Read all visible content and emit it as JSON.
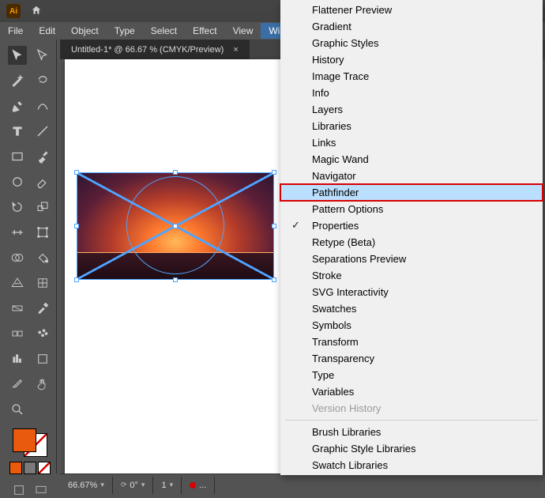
{
  "app": {
    "logo_text": "Ai"
  },
  "menus": [
    "File",
    "Edit",
    "Object",
    "Type",
    "Select",
    "Effect",
    "View",
    "Window"
  ],
  "open_menu": "Window",
  "tab": {
    "title": "Untitled-1* @ 66.67 % (CMYK/Preview)",
    "close": "×"
  },
  "status": {
    "zoom": "66.67%",
    "rotate": "0°",
    "layer": "1",
    "more": "..."
  },
  "swatches": {
    "fill": "#ea5a0e",
    "mini1": "#ea5a0e",
    "mini2": "#7a7a7a"
  },
  "window_menu": {
    "items": [
      {
        "label": "Flattener Preview"
      },
      {
        "label": "Gradient"
      },
      {
        "label": "Graphic Styles"
      },
      {
        "label": "History"
      },
      {
        "label": "Image Trace"
      },
      {
        "label": "Info"
      },
      {
        "label": "Layers"
      },
      {
        "label": "Libraries"
      },
      {
        "label": "Links"
      },
      {
        "label": "Magic Wand"
      },
      {
        "label": "Navigator"
      },
      {
        "label": "Pathfinder",
        "highlight": true,
        "boxed": true
      },
      {
        "label": "Pattern Options"
      },
      {
        "label": "Properties",
        "checked": true
      },
      {
        "label": "Retype (Beta)"
      },
      {
        "label": "Separations Preview"
      },
      {
        "label": "Stroke"
      },
      {
        "label": "SVG Interactivity"
      },
      {
        "label": "Swatches"
      },
      {
        "label": "Symbols"
      },
      {
        "label": "Transform"
      },
      {
        "label": "Transparency"
      },
      {
        "label": "Type"
      },
      {
        "label": "Variables"
      },
      {
        "label": "Version History",
        "disabled": true
      }
    ],
    "libs": [
      {
        "label": "Brush Libraries"
      },
      {
        "label": "Graphic Style Libraries"
      },
      {
        "label": "Swatch Libraries"
      }
    ]
  }
}
